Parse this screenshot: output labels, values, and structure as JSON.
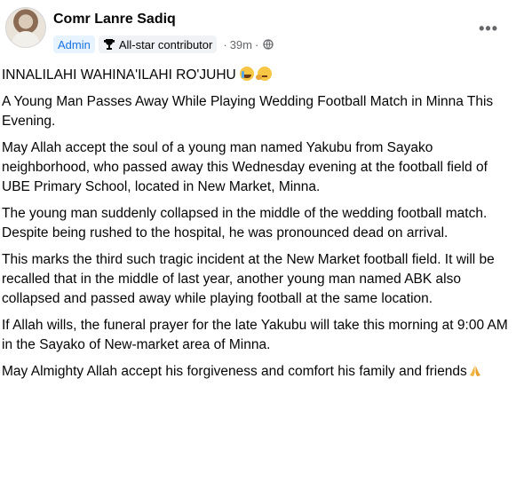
{
  "author": {
    "name": "Comr Lanre Sadiq",
    "badges": [
      "Admin",
      "All-star contributor"
    ],
    "time": "39m",
    "separator": "·"
  },
  "menu": {
    "more_label": "•••"
  },
  "post": {
    "paragraphs": [
      "INNALILAHI WAHINA'ILAHI RO'JUHU",
      "A Young Man Passes Away While Playing Wedding Football Match in Minna This Evening.",
      "May Allah accept the soul of a young man named Yakubu from Sayako neighborhood, who passed away this Wednesday evening at the football field of UBE Primary School, located in New Market, Minna.",
      "The young man suddenly collapsed in the middle of the wedding football match. Despite being rushed to the hospital, he was pronounced dead on arrival.",
      "This marks the third such tragic incident at the New Market football field. It will be recalled that in the middle of last year, another young man named ABK also collapsed and passed away while playing football at the same location.",
      "If Allah wills, the funeral prayer for the late Yakubu will take this morning at 9:00 AM in the Sayako of New-market area of Minna.",
      "May Almighty Allah accept his forgiveness and comfort his family and friends"
    ],
    "emoji_icons": [
      "crying-face-icon",
      "thinking-face-icon",
      "praying-hands-icon"
    ]
  },
  "colors": {
    "admin_badge_bg": "#e7f3ff",
    "admin_badge_text": "#1b74e4",
    "meta_text": "#65676b"
  }
}
